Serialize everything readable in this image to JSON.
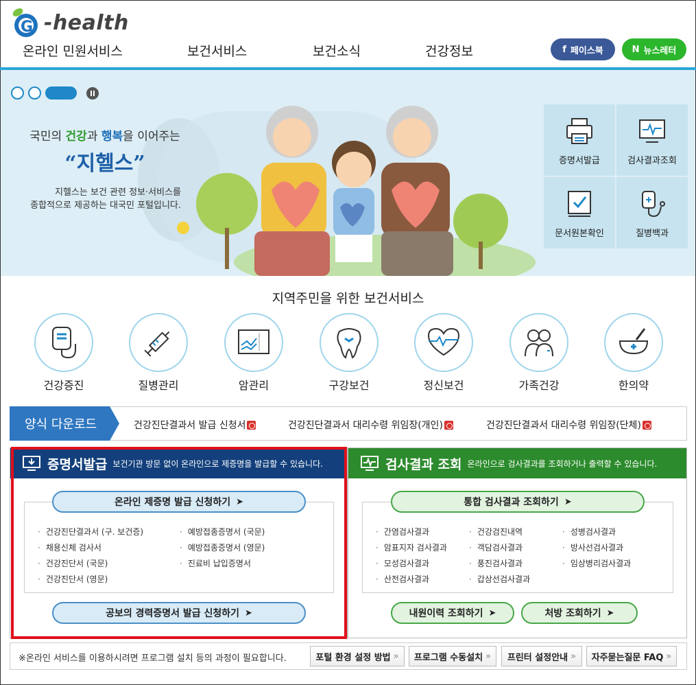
{
  "header": {
    "logo_text": "-health",
    "nav": [
      "온라인 민원서비스",
      "보건서비스",
      "보건소식",
      "건강정보"
    ],
    "facebook_label": "페이스북",
    "facebook_prefix": "f",
    "newsletter_label": "뉴스레터",
    "newsletter_prefix": "N"
  },
  "banner": {
    "slogan_pre": "국민의 ",
    "slogan_g": "건강",
    "slogan_mid": "과 ",
    "slogan_b": "행복",
    "slogan_post": "을 이어주는",
    "name": "“지헬스”",
    "desc_1": "지헬스는 보건 관련 정보·서비스를",
    "desc_2": "종합적으로 제공하는 대국민 포털입니다.",
    "quick": [
      "증명서발급",
      "검사결과조회",
      "문서원본확인",
      "질병백과"
    ]
  },
  "services": {
    "title": "지역주민을 위한 보건서비스",
    "items": [
      "건강증진",
      "질병관리",
      "암관리",
      "구강보건",
      "정신보건",
      "가족건강",
      "한의약"
    ]
  },
  "forms": {
    "title": "양식 다운로드",
    "links": [
      "건강진단결과서 발급 신청서",
      "건강진단결과서 대리수령 위임장(개인)",
      "건강진단결과서 대리수령 위임장(단체)"
    ]
  },
  "cert": {
    "title": "증명서발급",
    "subtitle": "보건기관 방문 없이 온라인으로 제증명을 발급할 수 있습니다.",
    "apply_label": "온라인 제증명 발급 신청하기",
    "col1": [
      "건강진단결과서 (구. 보건증)",
      "채용신체 검사서",
      "건강진단서 (국문)",
      "건강진단서 (영문)"
    ],
    "col2": [
      "예방접종증명서 (국문)",
      "예방접종증명서 (영문)",
      "진료비 납입증명서"
    ],
    "career_label": "공보의 경력증명서 발급 신청하기"
  },
  "result": {
    "title": "검사결과 조회",
    "subtitle": "온라인으로 검사결과를 조회하거나 출력할 수 있습니다.",
    "unified_label": "통합 검사결과 조회하기",
    "col1": [
      "간염검사결과",
      "암표지자 검사결과",
      "모성검사결과",
      "산전검사결과"
    ],
    "col2": [
      "건강검진내역",
      "객담검사결과",
      "풍진검사결과",
      "갑상선검사결과"
    ],
    "col3": [
      "성병검사결과",
      "방사선검사결과",
      "임상병리검사결과"
    ],
    "visit_label": "내원이력 조회하기",
    "rx_label": "처방 조회하기"
  },
  "footer": {
    "note": "※온라인 서비스를 이용하시려면 프로그램 설치 등의 과정이 필요합니다.",
    "buttons": [
      "포털 환경 설정 방법",
      "프로그램 수동설치",
      "프린터 설정안내",
      "자주묻는질문 FAQ"
    ]
  },
  "colors": {
    "accent": "#2aa7d8",
    "cert_head": "#13407c",
    "result_head": "#2c8b2c",
    "highlight": "#e0101b"
  }
}
